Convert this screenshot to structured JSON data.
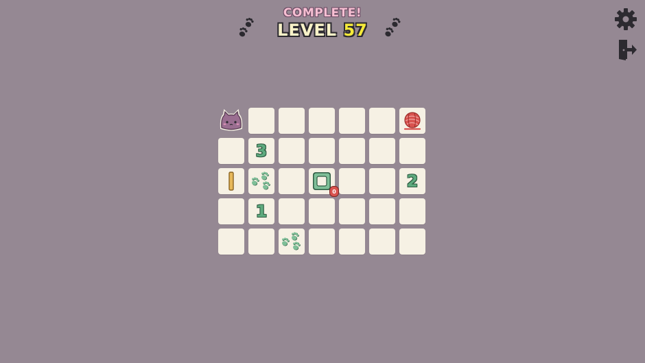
{
  "header": {
    "status": "COMPLETE!",
    "level_prefix": "LEVEL",
    "level_number": "57"
  },
  "colors": {
    "background": "#958893",
    "tile": "#f6f1e4",
    "accent_green": "#5eaa7e",
    "status_pink": "#f6bfd2",
    "level_yellow": "#f5ea3a",
    "yarn_red": "#d9534f",
    "stick_gold": "#e7b85a"
  },
  "board": {
    "rows": 5,
    "cols": 7,
    "cells": [
      [
        "cat",
        "blank",
        "blank",
        "blank",
        "blank",
        "blank",
        "yarn"
      ],
      [
        "blank",
        "number",
        "blank",
        "blank",
        "blank",
        "blank",
        "blank"
      ],
      [
        "stick",
        "pawprints",
        "blank",
        "ring",
        "blank",
        "blank",
        "number"
      ],
      [
        "blank",
        "number",
        "blank",
        "blank",
        "blank",
        "blank",
        "blank"
      ],
      [
        "blank",
        "blank",
        "pawprints",
        "blank",
        "blank",
        "blank",
        "blank"
      ]
    ],
    "numbers": {
      "r1c1": "3",
      "r2c6": "2",
      "r3c1": "1"
    },
    "ring_badge": "0"
  },
  "icons": {
    "settings": "gear-icon",
    "exit": "exit-door-icon",
    "paw": "paw-prints-icon",
    "player": "cat-face-icon",
    "goal": "yarn-ball-icon"
  }
}
